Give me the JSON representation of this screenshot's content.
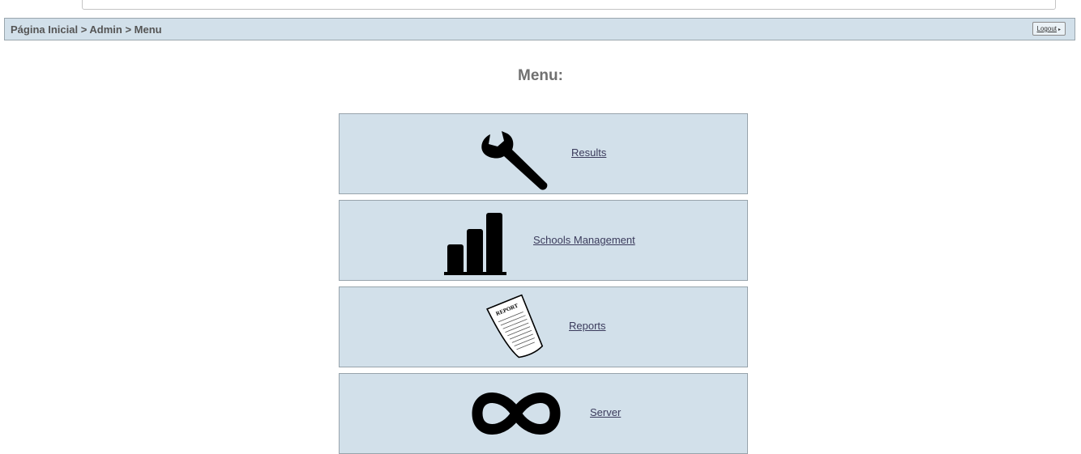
{
  "breadcrumb": {
    "text": "Página Inicial > Admin > Menu"
  },
  "header": {
    "logout_label": "Logout",
    "logout_arrow": "▸"
  },
  "page": {
    "title": "Menu:"
  },
  "menu": {
    "items": [
      {
        "label": "Results",
        "icon": "wrench-icon"
      },
      {
        "label": "Schools Management",
        "icon": "bar-chart-icon"
      },
      {
        "label": "Reports",
        "icon": "report-document-icon"
      },
      {
        "label": "Server",
        "icon": "infinity-icon"
      }
    ]
  },
  "colors": {
    "tile_background": "#d2e0ea",
    "tile_border": "#98a4ac",
    "link": "#3b3b5c",
    "title": "#707070",
    "breadcrumb_text": "#555555"
  }
}
